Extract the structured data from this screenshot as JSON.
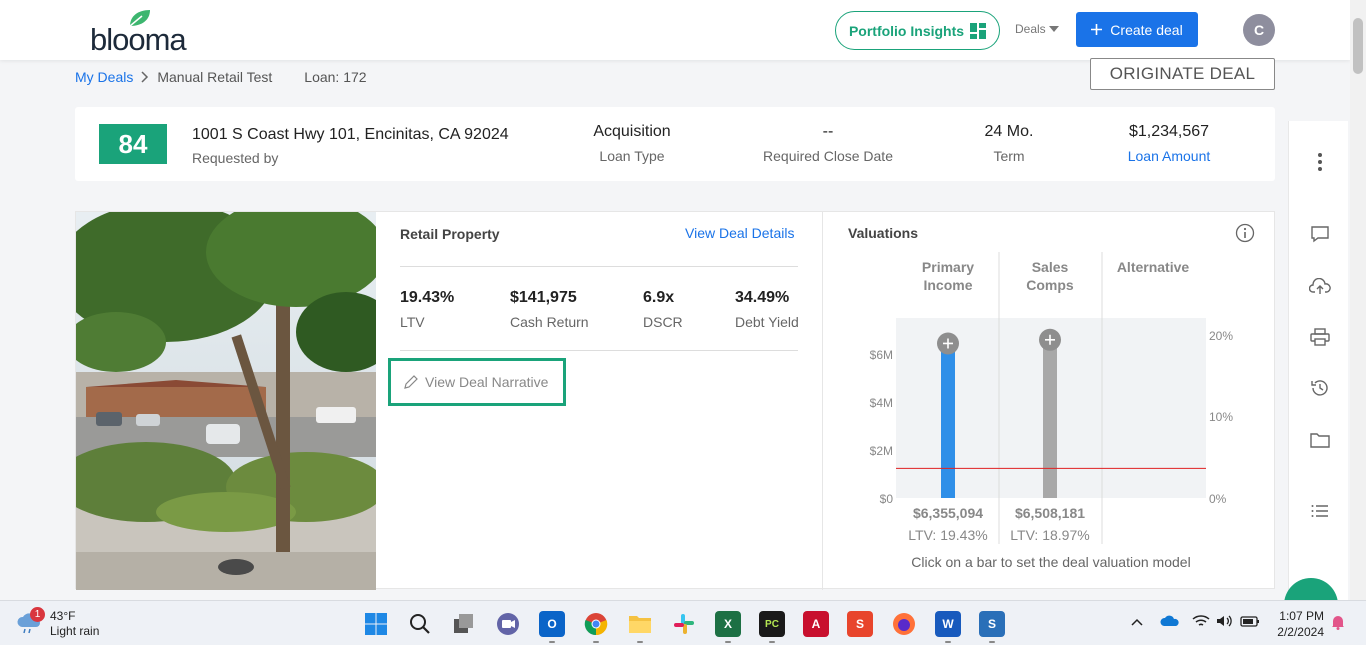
{
  "header": {
    "logo_text": "blooma",
    "portfolio_insights_label": "Portfolio Insights",
    "deals_menu_label": "Deals",
    "create_deal_label": "Create deal",
    "avatar_initial": "C"
  },
  "breadcrumb": {
    "root": "My Deals",
    "current": "Manual Retail Test",
    "loan": "Loan: 172"
  },
  "originate_label": "ORIGINATE DEAL",
  "summary": {
    "score": "84",
    "address": "1001 S Coast Hwy 101, Encinitas, CA 92024",
    "requested_by": "Requested by",
    "loan_type_value": "Acquisition",
    "loan_type_label": "Loan Type",
    "close_date_value": "--",
    "close_date_label": "Required Close Date",
    "term_value": "24 Mo.",
    "term_label": "Term",
    "loan_amount_value": "$1,234,567",
    "loan_amount_label": "Loan Amount"
  },
  "property": {
    "title": "Retail Property",
    "view_details": "View Deal Details",
    "metrics": [
      {
        "value": "19.43%",
        "label": "LTV"
      },
      {
        "value": "$141,975",
        "label": "Cash Return"
      },
      {
        "value": "6.9x",
        "label": "DSCR"
      },
      {
        "value": "34.49%",
        "label": "Debt Yield"
      }
    ],
    "narrative_label": "View Deal Narrative"
  },
  "valuations": {
    "title": "Valuations",
    "note": "Click on a bar to set the deal valuation model"
  },
  "chart_data": {
    "type": "bar",
    "title": "Valuations",
    "categories": [
      "Primary Income",
      "Sales Comps",
      "Alternative"
    ],
    "values": [
      6355094,
      6508181,
      null
    ],
    "value_labels": [
      "$6,355,094",
      "$6,508,181"
    ],
    "ltv_labels": [
      "LTV: 19.43%",
      "LTV: 18.97%"
    ],
    "left_ticks": [
      "$0",
      "$2M",
      "$4M",
      "$6M"
    ],
    "right_ticks": [
      "0%",
      "10%",
      "20%"
    ],
    "ylim": [
      0,
      7500000
    ],
    "reference_line_value": 1234567,
    "series_colors": [
      "#2f8fe8",
      "#a8a8a8"
    ],
    "reference_line_color": "#e02020"
  },
  "taskbar": {
    "weather_temp": "43°F",
    "weather_desc": "Light rain",
    "weather_badge": "1",
    "time": "1:07 PM",
    "date": "2/2/2024"
  },
  "colors": {
    "brand_green": "#1aa37a",
    "primary_blue": "#1a73e8"
  }
}
